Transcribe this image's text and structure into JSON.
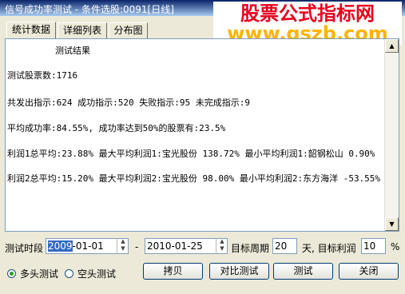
{
  "window": {
    "title": "信号成功率测试 - 条件选股:0091[日线]"
  },
  "watermark": {
    "line1": "股票公式指标网",
    "line2": "www.gszb.com"
  },
  "tabs": [
    "统计数据",
    "详细列表",
    "分布图"
  ],
  "results": {
    "heading": "测试结果",
    "lines": [
      "测试股票数:1716",
      "共发出指示:624 成功指示:520 失败指示:95 未完成指示:9",
      "平均成功率:84.55%, 成功率达到50%的股票有:23.5%",
      "利润1总平均:23.88% 最大平均利润1:宝光股份 138.72% 最小平均利润1:韶钢松山 0.90%",
      "利润2总平均:15.20% 最大平均利润2:宝光股份 98.00% 最小平均利润2:东方海洋 -53.55%"
    ]
  },
  "period": {
    "label": "测试时段",
    "start_selected": "2009",
    "start_rest": "-01-01",
    "dash": "-",
    "end": "2010-01-25",
    "target_period_label": "目标周期",
    "target_period_value": "20",
    "target_profit_label": "天, 目标利润",
    "target_profit_value": "10",
    "percent": "%"
  },
  "mode": {
    "long": "多头测试",
    "short": "空头测试",
    "selected": "long"
  },
  "buttons": {
    "copy": "拷贝",
    "compare": "对比测试",
    "test": "测试",
    "close": "关闭"
  }
}
